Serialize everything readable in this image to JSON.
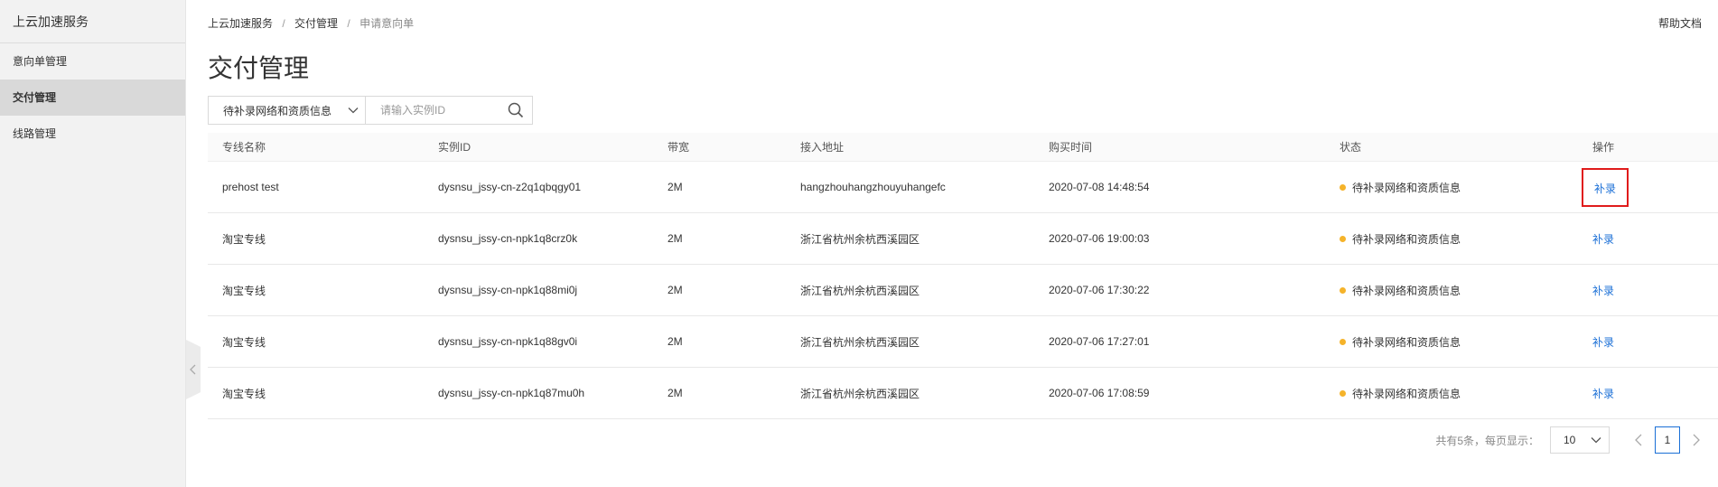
{
  "sidebar": {
    "brand": "上云加速服务",
    "items": [
      {
        "label": "意向单管理"
      },
      {
        "label": "交付管理"
      },
      {
        "label": "线路管理"
      }
    ]
  },
  "breadcrumb": {
    "items": [
      "上云加速服务",
      "交付管理",
      "申请意向单"
    ],
    "separator": "/"
  },
  "header": {
    "help_label": "帮助文档",
    "title": "交付管理"
  },
  "filter": {
    "status_value": "待补录网络和资质信息",
    "search_placeholder": "请输入实例ID"
  },
  "table": {
    "headers": [
      "专线名称",
      "实例ID",
      "带宽",
      "接入地址",
      "购买时间",
      "状态",
      "操作"
    ],
    "rows": [
      {
        "name": "prehost test",
        "instance_id": "dysnsu_jssy-cn-z2q1qbqgy01",
        "bandwidth": "2M",
        "address": "hangzhouhangzhouyuhangefc",
        "purchase_time": "2020-07-08 14:48:54",
        "status": "待补录网络和资质信息",
        "action": "补录"
      },
      {
        "name": "淘宝专线",
        "instance_id": "dysnsu_jssy-cn-npk1q8crz0k",
        "bandwidth": "2M",
        "address": "浙江省杭州余杭西溪园区",
        "purchase_time": "2020-07-06 19:00:03",
        "status": "待补录网络和资质信息",
        "action": "补录"
      },
      {
        "name": "淘宝专线",
        "instance_id": "dysnsu_jssy-cn-npk1q88mi0j",
        "bandwidth": "2M",
        "address": "浙江省杭州余杭西溪园区",
        "purchase_time": "2020-07-06 17:30:22",
        "status": "待补录网络和资质信息",
        "action": "补录"
      },
      {
        "name": "淘宝专线",
        "instance_id": "dysnsu_jssy-cn-npk1q88gv0i",
        "bandwidth": "2M",
        "address": "浙江省杭州余杭西溪园区",
        "purchase_time": "2020-07-06 17:27:01",
        "status": "待补录网络和资质信息",
        "action": "补录"
      },
      {
        "name": "淘宝专线",
        "instance_id": "dysnsu_jssy-cn-npk1q87mu0h",
        "bandwidth": "2M",
        "address": "浙江省杭州余杭西溪园区",
        "purchase_time": "2020-07-06 17:08:59",
        "status": "待补录网络和资质信息",
        "action": "补录"
      }
    ]
  },
  "pagination": {
    "total_text": "共有5条，每页显示：",
    "page_size": "10",
    "current_page": "1"
  },
  "colors": {
    "link": "#1a6fd6",
    "status_dot": "#f5b32a",
    "highlight_border": "#e01b1b"
  },
  "icons": {
    "chevron": "chevron-down-icon",
    "search": "search-icon",
    "prev": "chevron-left-icon",
    "next": "chevron-right-icon",
    "collapse": "chevron-left-icon"
  }
}
